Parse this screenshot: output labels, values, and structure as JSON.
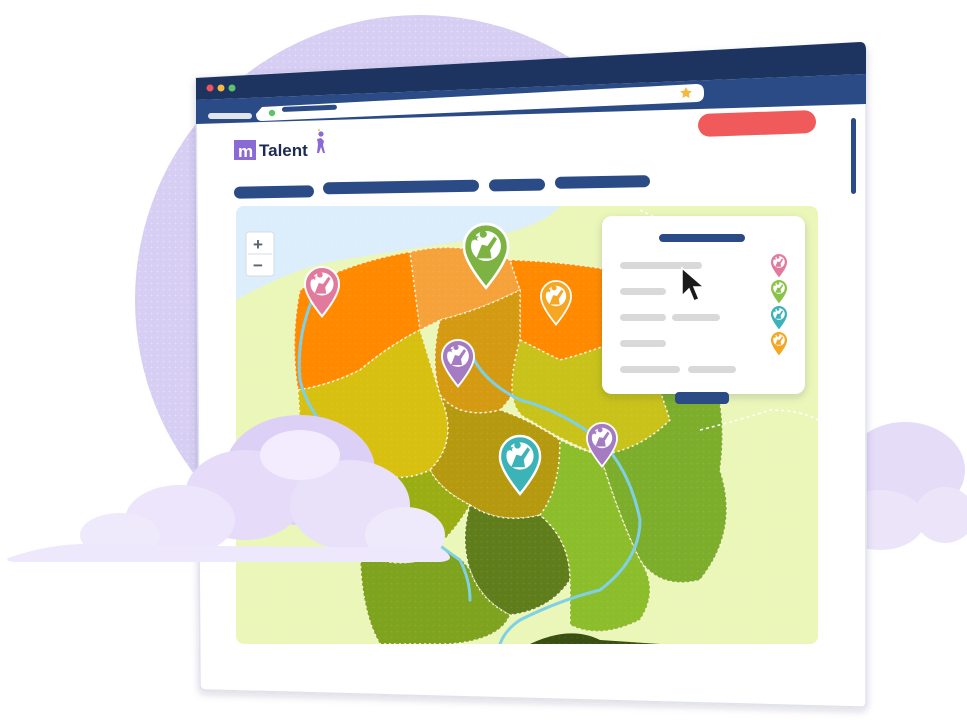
{
  "brand": {
    "logo_letter": "m",
    "name": "Talent"
  },
  "window": {
    "traffic_lights": [
      "#f0545a",
      "#f5b940",
      "#5fc26b"
    ]
  },
  "address_bar": {
    "bookmark_icon": "star-icon",
    "star_color": "#f5b940"
  },
  "header": {
    "cta_color": "#f05a5b"
  },
  "nav": {
    "items": 4,
    "color": "#2b4b86"
  },
  "map": {
    "zoom_in": "+",
    "zoom_out": "−",
    "pins": [
      {
        "color": "#e27a9e",
        "icon": "person-star-icon"
      },
      {
        "color": "#7cb342",
        "icon": "person-star-icon"
      },
      {
        "color": "#f5a623",
        "icon": "person-star-icon"
      },
      {
        "color": "#a57cc1",
        "icon": "person-star-icon"
      },
      {
        "color": "#3bb3b8",
        "icon": "person-star-icon"
      },
      {
        "color": "#a57cc1",
        "icon": "person-star-icon"
      }
    ]
  },
  "legend": {
    "entries": [
      {
        "color": "#e27a9e"
      },
      {
        "color": "#8bc34a"
      },
      {
        "color": "#3bb3b8"
      },
      {
        "color": "#f5a623"
      }
    ]
  },
  "cursor": {
    "icon": "pointer-cursor-icon"
  }
}
